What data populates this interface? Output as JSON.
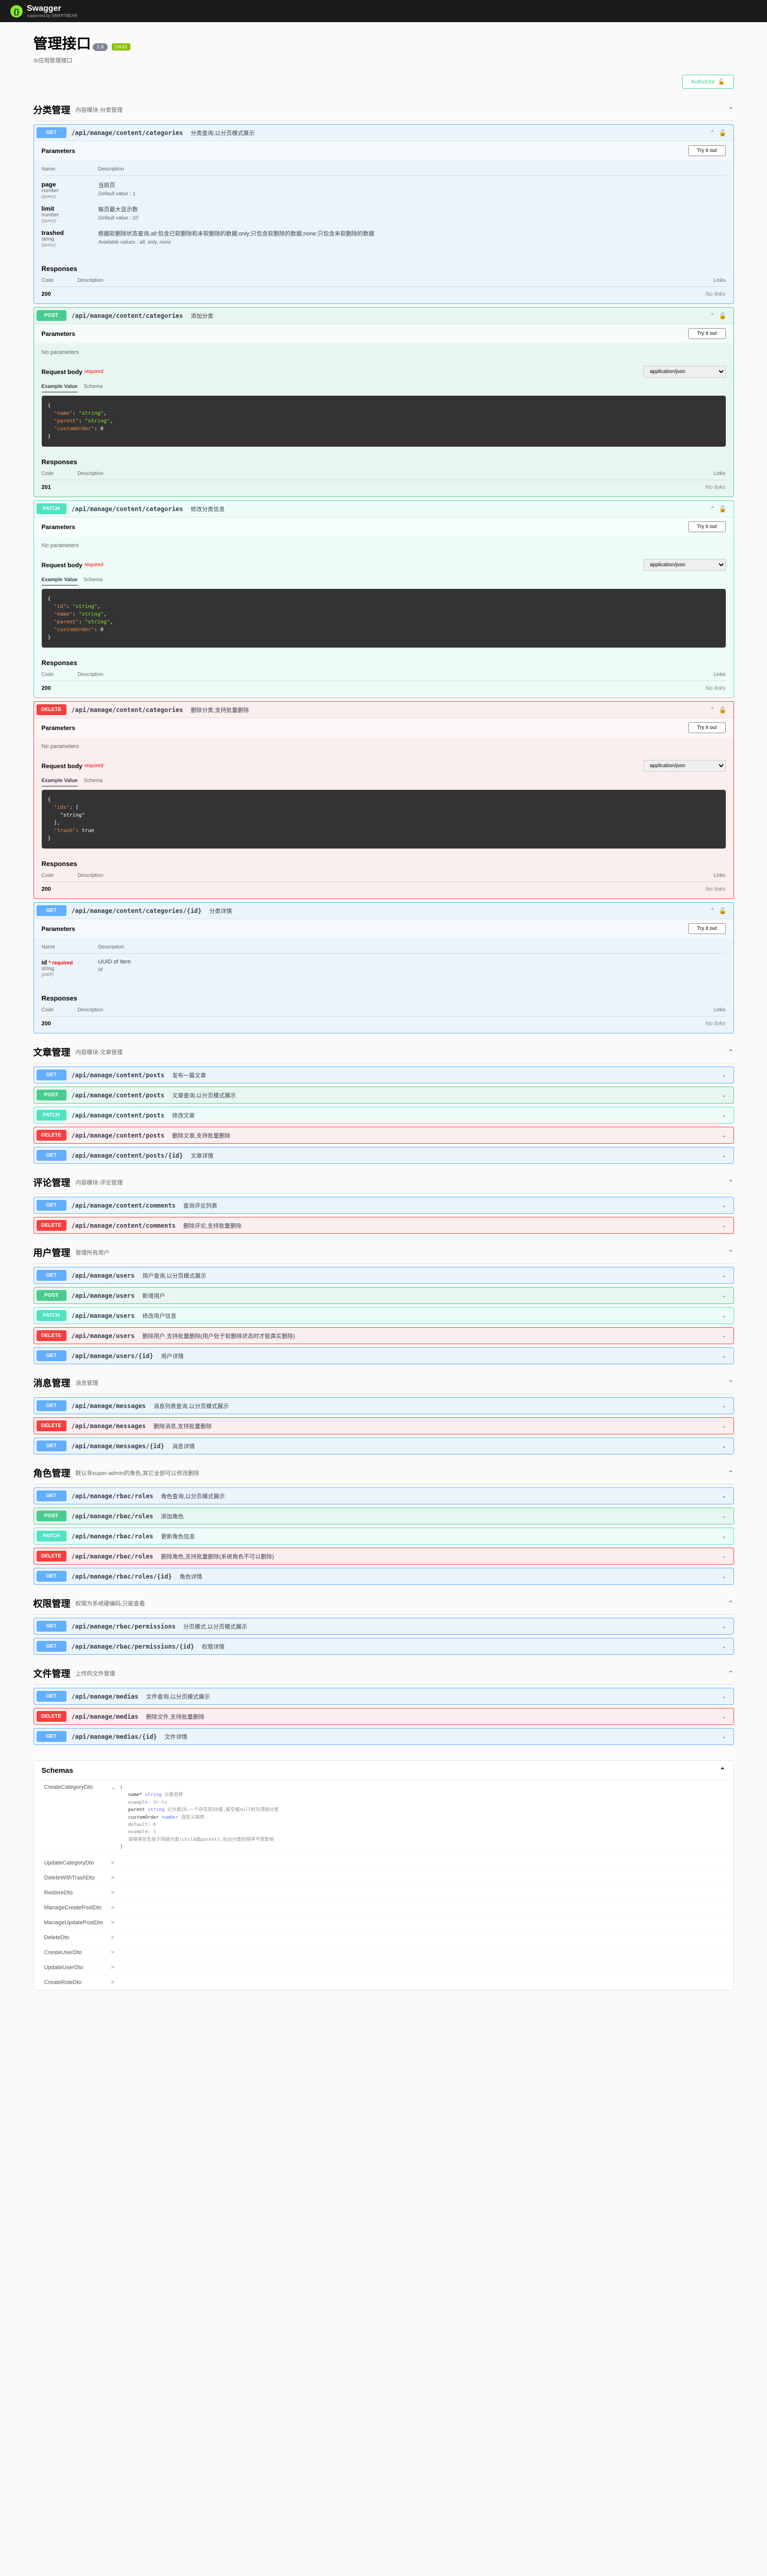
{
  "topbar": {
    "logo_text": "Swagger",
    "logo_sub": "supported by SMARTBEAR"
  },
  "header": {
    "title": "管理接口",
    "version": "1.0",
    "oas": "OAS3",
    "desc": "3r应用管理接口"
  },
  "authorize": "Authorize",
  "try_it_out": "Try it out",
  "no_params": "No parameters",
  "req_body": "Request body",
  "required": "required",
  "content_type": "application/json",
  "tab_example": "Example Value",
  "tab_schema": "Schema",
  "responses_h": "Responses",
  "col_name": "Name",
  "col_desc": "Description",
  "col_code": "Code",
  "col_links": "Links",
  "no_links": "No links",
  "code_200": "200",
  "code_201": "201",
  "tags": [
    {
      "name": "分类管理",
      "desc": "内容模块-分类管理",
      "ops": [
        {
          "m": "GET",
          "mc": "get",
          "p": "/api/manage/content/categories",
          "s": "分类查询,以分页模式展示",
          "open": true,
          "lock": true,
          "resp": "200",
          "params": [
            {
              "name": "page",
              "type": "number",
              "in": "(query)",
              "desc": "当前页",
              "dv": "Default value : 1"
            },
            {
              "name": "limit",
              "type": "number",
              "in": "(query)",
              "desc": "每页最大显示数",
              "dv": "Default value : 10"
            },
            {
              "name": "trashed",
              "type": "string",
              "in": "(query)",
              "desc": "根据软删除状态查询,all:包含已软删除和未软删除的数据;only:只包含软删除的数据;none:只包含未软删除的数据",
              "av": "Available values : all, only, none"
            }
          ]
        },
        {
          "m": "POST",
          "mc": "post",
          "p": "/api/manage/content/categories",
          "s": "添加分类",
          "open": true,
          "lock": true,
          "resp": "201",
          "body": "{\n  \"name\": \"string\",\n  \"parent\": \"string\",\n  \"customOrder\": 0\n}"
        },
        {
          "m": "PATCH",
          "mc": "patch",
          "p": "/api/manage/content/categories",
          "s": "修改分类信息",
          "open": true,
          "lock": true,
          "resp": "200",
          "body": "{\n  \"id\": \"string\",\n  \"name\": \"string\",\n  \"parent\": \"string\",\n  \"customOrder\": 0\n}"
        },
        {
          "m": "DELETE",
          "mc": "delete",
          "p": "/api/manage/content/categories",
          "s": "删除分类,支持批量删除",
          "open": true,
          "lock": true,
          "resp": "200",
          "body": "{\n  \"ids\": [\n    \"string\"\n  ],\n  \"trash\": true\n}"
        },
        {
          "m": "GET",
          "mc": "get",
          "p": "/api/manage/content/categories/{id}",
          "s": "分类详情",
          "open": true,
          "lock": true,
          "resp": "200",
          "params": [
            {
              "name": "id",
              "req": true,
              "type": "string",
              "in": "(path)",
              "desc": "UUID of Item",
              "dv": "Id"
            }
          ]
        }
      ]
    },
    {
      "name": "文章管理",
      "desc": "内容模块-文章管理",
      "ops": [
        {
          "m": "GET",
          "mc": "get",
          "p": "/api/manage/content/posts",
          "s": "发布一篇文章"
        },
        {
          "m": "POST",
          "mc": "post",
          "p": "/api/manage/content/posts",
          "s": "文章查询,以分页模式展示"
        },
        {
          "m": "PATCH",
          "mc": "patch",
          "p": "/api/manage/content/posts",
          "s": "修改文章"
        },
        {
          "m": "DELETE",
          "mc": "delete",
          "p": "/api/manage/content/posts",
          "s": "删除文章,支持批量删除"
        },
        {
          "m": "GET",
          "mc": "get",
          "p": "/api/manage/content/posts/{id}",
          "s": "文章详情"
        }
      ]
    },
    {
      "name": "评论管理",
      "desc": "内容模块-评论管理",
      "ops": [
        {
          "m": "GET",
          "mc": "get",
          "p": "/api/manage/content/comments",
          "s": "查询评论列表"
        },
        {
          "m": "DELETE",
          "mc": "delete",
          "p": "/api/manage/content/comments",
          "s": "删除评论,支持批量删除"
        }
      ]
    },
    {
      "name": "用户管理",
      "desc": "管理所有用户",
      "ops": [
        {
          "m": "GET",
          "mc": "get",
          "p": "/api/manage/users",
          "s": "用户查询,以分页模式展示"
        },
        {
          "m": "POST",
          "mc": "post",
          "p": "/api/manage/users",
          "s": "新增用户"
        },
        {
          "m": "PATCH",
          "mc": "patch",
          "p": "/api/manage/users",
          "s": "修改用户信息"
        },
        {
          "m": "DELETE",
          "mc": "delete",
          "p": "/api/manage/users",
          "s": "删除用户,支持批量删除(用户处于软删除状态时才能真实删除)"
        },
        {
          "m": "GET",
          "mc": "get",
          "p": "/api/manage/users/{id}",
          "s": "用户详情"
        }
      ]
    },
    {
      "name": "消息管理",
      "desc": "消息管理",
      "ops": [
        {
          "m": "GET",
          "mc": "get",
          "p": "/api/manage/messages",
          "s": "消息列表查询,以分页模式展示"
        },
        {
          "m": "DELETE",
          "mc": "delete",
          "p": "/api/manage/messages",
          "s": "删除消息,支持批量删除"
        },
        {
          "m": "GET",
          "mc": "get",
          "p": "/api/manage/messages/{id}",
          "s": "消息详情"
        }
      ]
    },
    {
      "name": "角色管理",
      "desc": "默认非super-admin的角色,其它全部可以修改删除",
      "ops": [
        {
          "m": "GET",
          "mc": "get",
          "p": "/api/manage/rbac/roles",
          "s": "角色查询,以分页模式展示"
        },
        {
          "m": "POST",
          "mc": "post",
          "p": "/api/manage/rbac/roles",
          "s": "添加角色"
        },
        {
          "m": "PATCH",
          "mc": "patch",
          "p": "/api/manage/rbac/roles",
          "s": "更新角色信息"
        },
        {
          "m": "DELETE",
          "mc": "delete",
          "p": "/api/manage/rbac/roles",
          "s": "删除角色,支持批量删除(系统角色不可以删除)"
        },
        {
          "m": "GET",
          "mc": "get",
          "p": "/api/manage/rbac/roles/{id}",
          "s": "角色详情"
        }
      ]
    },
    {
      "name": "权限管理",
      "desc": "权限为系统硬编码,只能查看",
      "ops": [
        {
          "m": "GET",
          "mc": "get",
          "p": "/api/manage/rbac/permissions",
          "s": "分页模式,以分页模式展示"
        },
        {
          "m": "GET",
          "mc": "get",
          "p": "/api/manage/rbac/permissions/{id}",
          "s": "权限详情"
        }
      ]
    },
    {
      "name": "文件管理",
      "desc": "上传的文件管理",
      "ops": [
        {
          "m": "GET",
          "mc": "get",
          "p": "/api/manage/medias",
          "s": "文件查询,以分页模式展示"
        },
        {
          "m": "DELETE",
          "mc": "delete",
          "p": "/api/manage/medias",
          "s": "删除文件,支持批量删除"
        },
        {
          "m": "GET",
          "mc": "get",
          "p": "/api/manage/medias/{id}",
          "s": "文件详情"
        }
      ]
    }
  ],
  "schemas_h": "Schemas",
  "schemas": [
    {
      "name": "CreateCategoryDto",
      "open": true,
      "props": [
        {
          "n": "name*",
          "t": "string",
          "d": "分类名称"
        },
        {
          "n": "",
          "t": "",
          "d": "example: 3r-ts"
        },
        {
          "n": "parent",
          "t": "string",
          "d": "父分类ID,一个存在的ID值,留空或null时为顶级分类"
        },
        {
          "n": "customOrder",
          "t": "number",
          "d": "自定义排序"
        },
        {
          "n": "",
          "t": "",
          "d": "default: 0"
        },
        {
          "n": "",
          "t": "",
          "d": "example: 1"
        },
        {
          "n": "",
          "t": "",
          "d": "该排序仅生效于同级分类(child或parent),后台分类的排序不受影响"
        }
      ]
    },
    {
      "name": "UpdateCategoryDto"
    },
    {
      "name": "DeleteWithTrashDto"
    },
    {
      "name": "RestoreDto"
    },
    {
      "name": "ManageCreatePostDto"
    },
    {
      "name": "ManageUpdatePostDto"
    },
    {
      "name": "DeleteDto"
    },
    {
      "name": "CreateUserDto"
    },
    {
      "name": "UpdateUserDto"
    },
    {
      "name": "CreateRoleDto"
    }
  ]
}
